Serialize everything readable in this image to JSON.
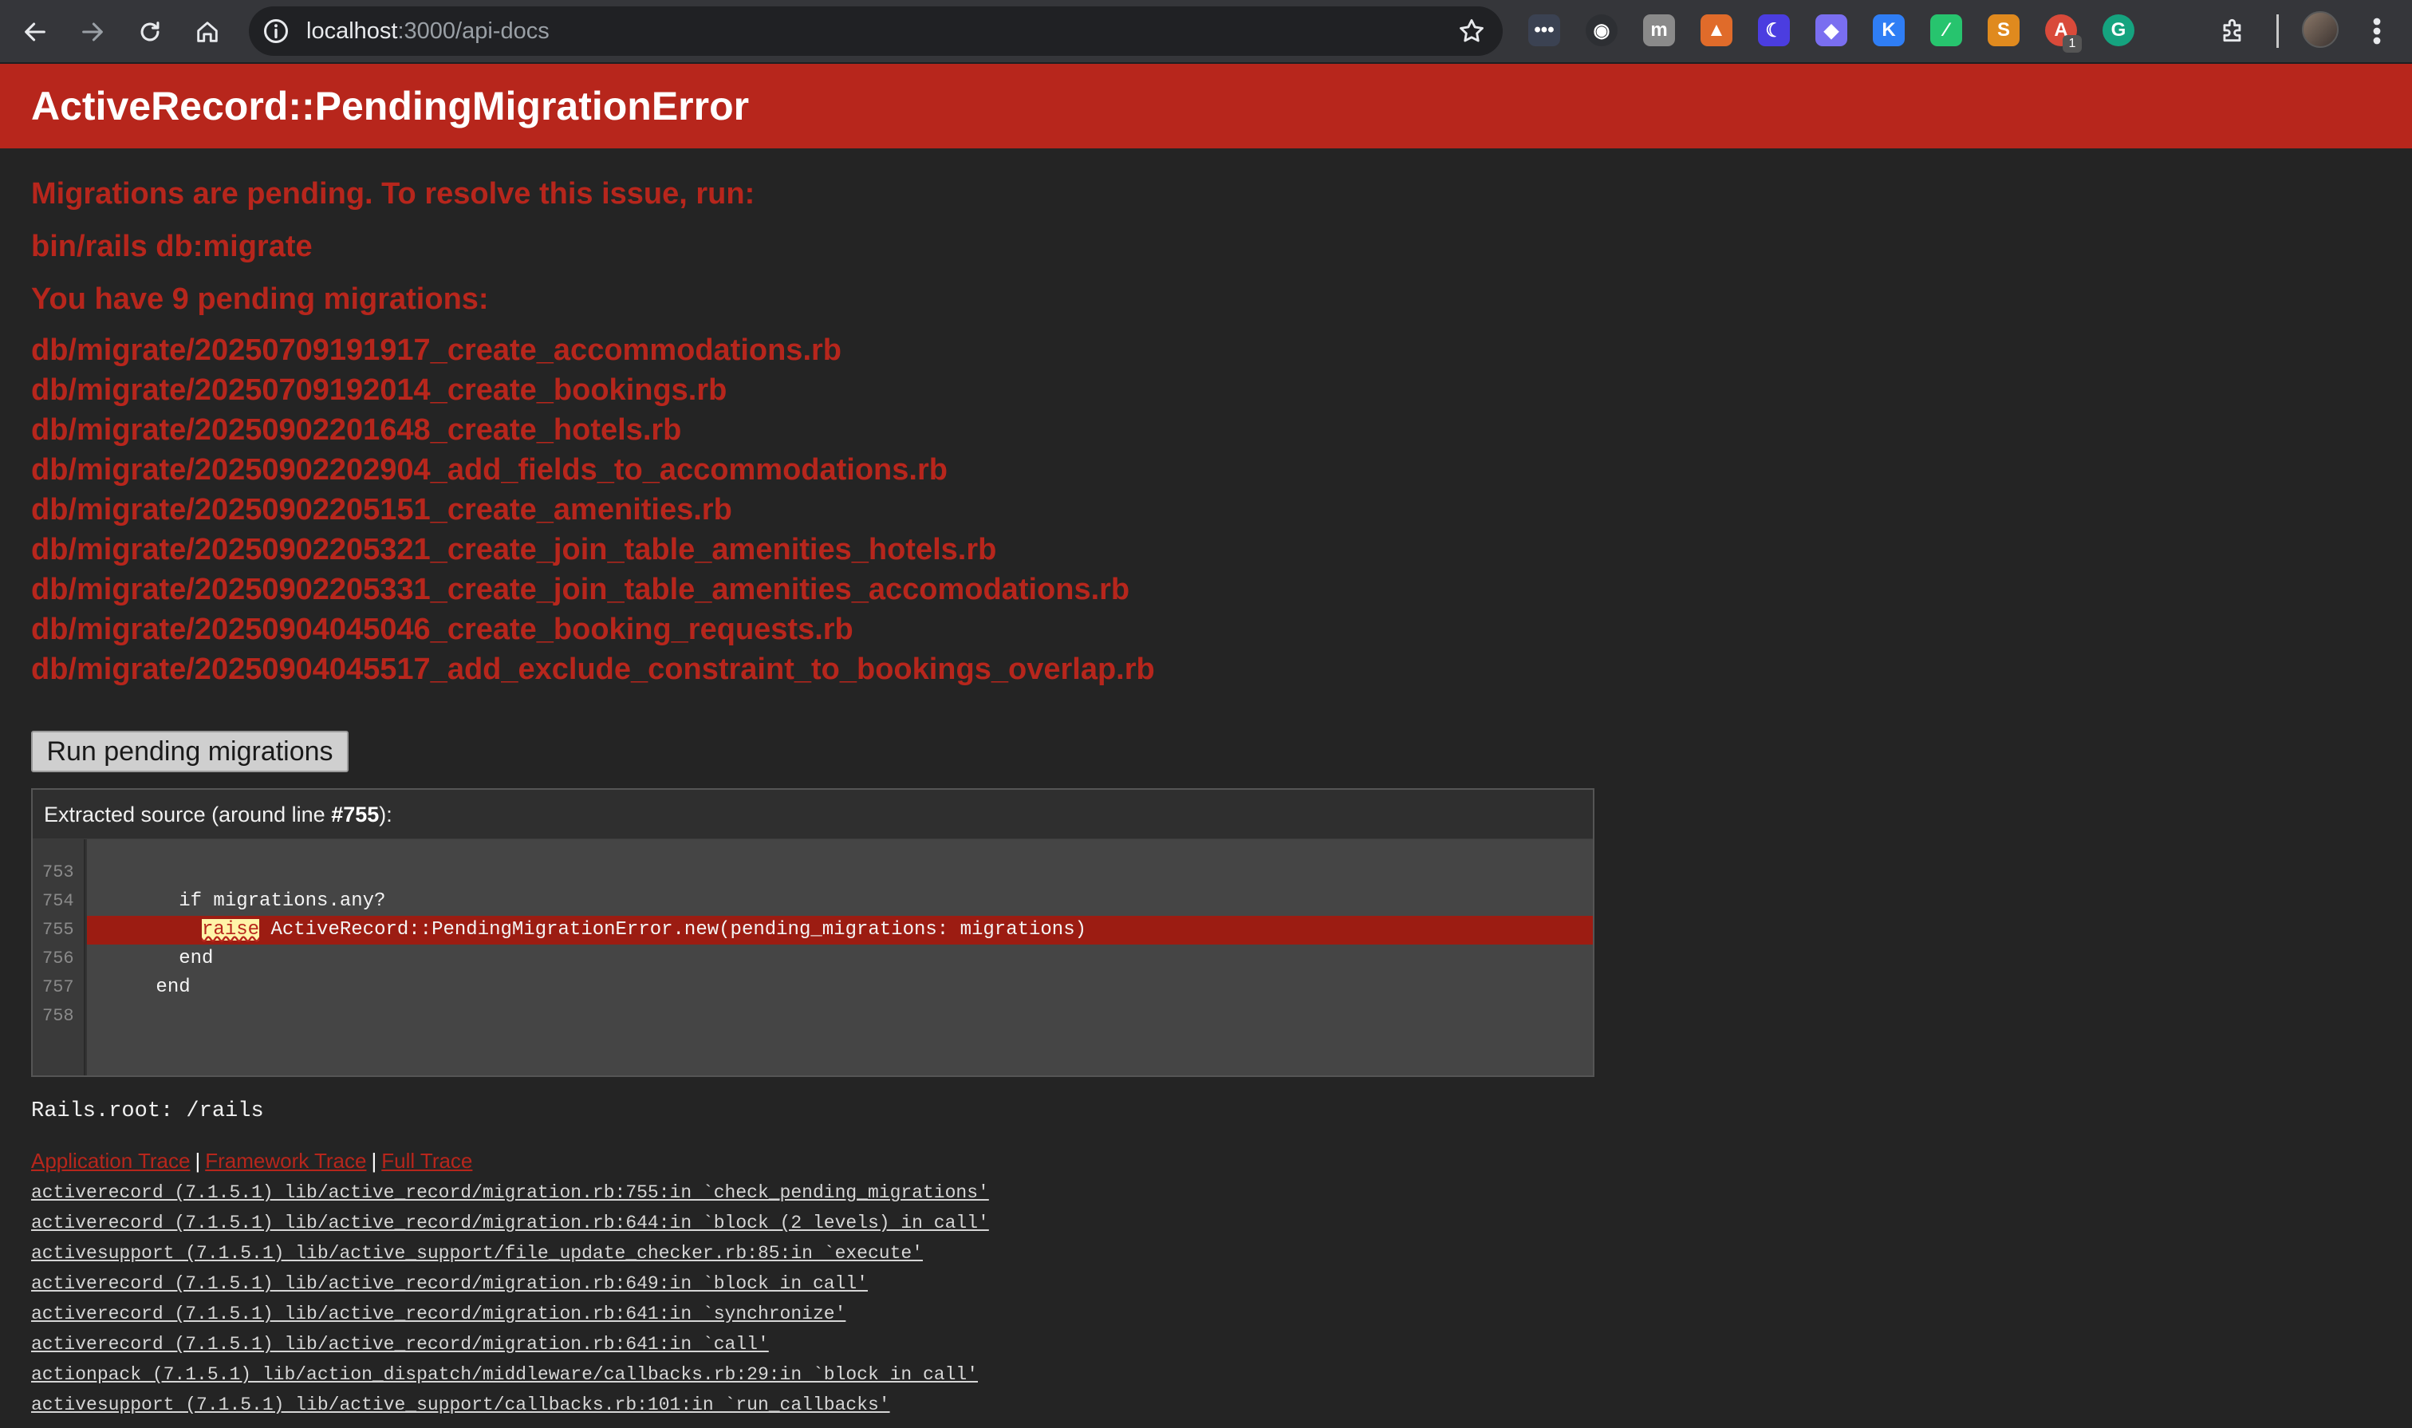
{
  "browser": {
    "url_host": "localhost",
    "url_path": ":3000/api-docs",
    "extensions": [
      {
        "name": "more-extension-icon",
        "glyph": "•••",
        "color": "#3b4252"
      },
      {
        "name": "lens-extension-icon",
        "glyph": "◉",
        "color": "#2d2f33"
      },
      {
        "name": "m-extension-icon",
        "glyph": "m",
        "color": "#8a8a8a"
      },
      {
        "name": "fox-extension-icon",
        "glyph": "▲",
        "color": "#e06b2a"
      },
      {
        "name": "moon-extension-icon",
        "glyph": "☾",
        "color": "#4b3de0"
      },
      {
        "name": "ghost-extension-icon",
        "glyph": "◆",
        "color": "#7a6ef0"
      },
      {
        "name": "k-extension-icon",
        "glyph": "K",
        "color": "#2f7ef5"
      },
      {
        "name": "pen-extension-icon",
        "glyph": "∕",
        "color": "#27c46e"
      },
      {
        "name": "s-extension-icon",
        "glyph": "S",
        "color": "#e08a1e"
      },
      {
        "name": "api-extension-icon",
        "glyph": "A",
        "color": "#d94a3a",
        "badge": "1"
      },
      {
        "name": "grammarly-extension-icon",
        "glyph": "G",
        "color": "#15a37f"
      }
    ]
  },
  "error": {
    "title": "ActiveRecord::PendingMigrationError",
    "message": "Migrations are pending. To resolve this issue, run:",
    "command": "bin/rails db:migrate",
    "pending_count_text": "You have 9 pending migrations:",
    "migrations": [
      "db/migrate/20250709191917_create_accommodations.rb",
      "db/migrate/20250709192014_create_bookings.rb",
      "db/migrate/20250902201648_create_hotels.rb",
      "db/migrate/20250902202904_add_fields_to_accommodations.rb",
      "db/migrate/20250902205151_create_amenities.rb",
      "db/migrate/20250902205321_create_join_table_amenities_hotels.rb",
      "db/migrate/20250902205331_create_join_table_amenities_accomodations.rb",
      "db/migrate/20250904045046_create_booking_requests.rb",
      "db/migrate/20250904045517_add_exclude_constraint_to_bookings_overlap.rb"
    ],
    "run_button_label": "Run pending migrations"
  },
  "source": {
    "header_prefix": "Extracted source (around line ",
    "header_line": "#755",
    "header_suffix": "):",
    "line_numbers": [
      "753",
      "754",
      "755",
      "756",
      "757",
      "758"
    ],
    "lines": [
      "",
      "        if migrations.any?",
      "          ",
      "        end",
      "      end",
      ""
    ],
    "highlight_keyword": "raise",
    "highlight_rest": " ActiveRecord::PendingMigrationError.new(pending_migrations: migrations)"
  },
  "rails_root": "Rails.root: /rails",
  "trace": {
    "tabs": [
      "Application Trace",
      "Framework Trace",
      "Full Trace"
    ],
    "separator": "|",
    "lines": [
      "activerecord (7.1.5.1) lib/active_record/migration.rb:755:in `check_pending_migrations'",
      "activerecord (7.1.5.1) lib/active_record/migration.rb:644:in `block (2 levels) in call'",
      "activesupport (7.1.5.1) lib/active_support/file_update_checker.rb:85:in `execute'",
      "activerecord (7.1.5.1) lib/active_record/migration.rb:649:in `block in call'",
      "activerecord (7.1.5.1) lib/active_record/migration.rb:641:in `synchronize'",
      "activerecord (7.1.5.1) lib/active_record/migration.rb:641:in `call'",
      "actionpack (7.1.5.1) lib/action_dispatch/middleware/callbacks.rb:29:in `block in call'",
      "activesupport (7.1.5.1) lib/active_support/callbacks.rb:101:in `run_callbacks'"
    ]
  }
}
